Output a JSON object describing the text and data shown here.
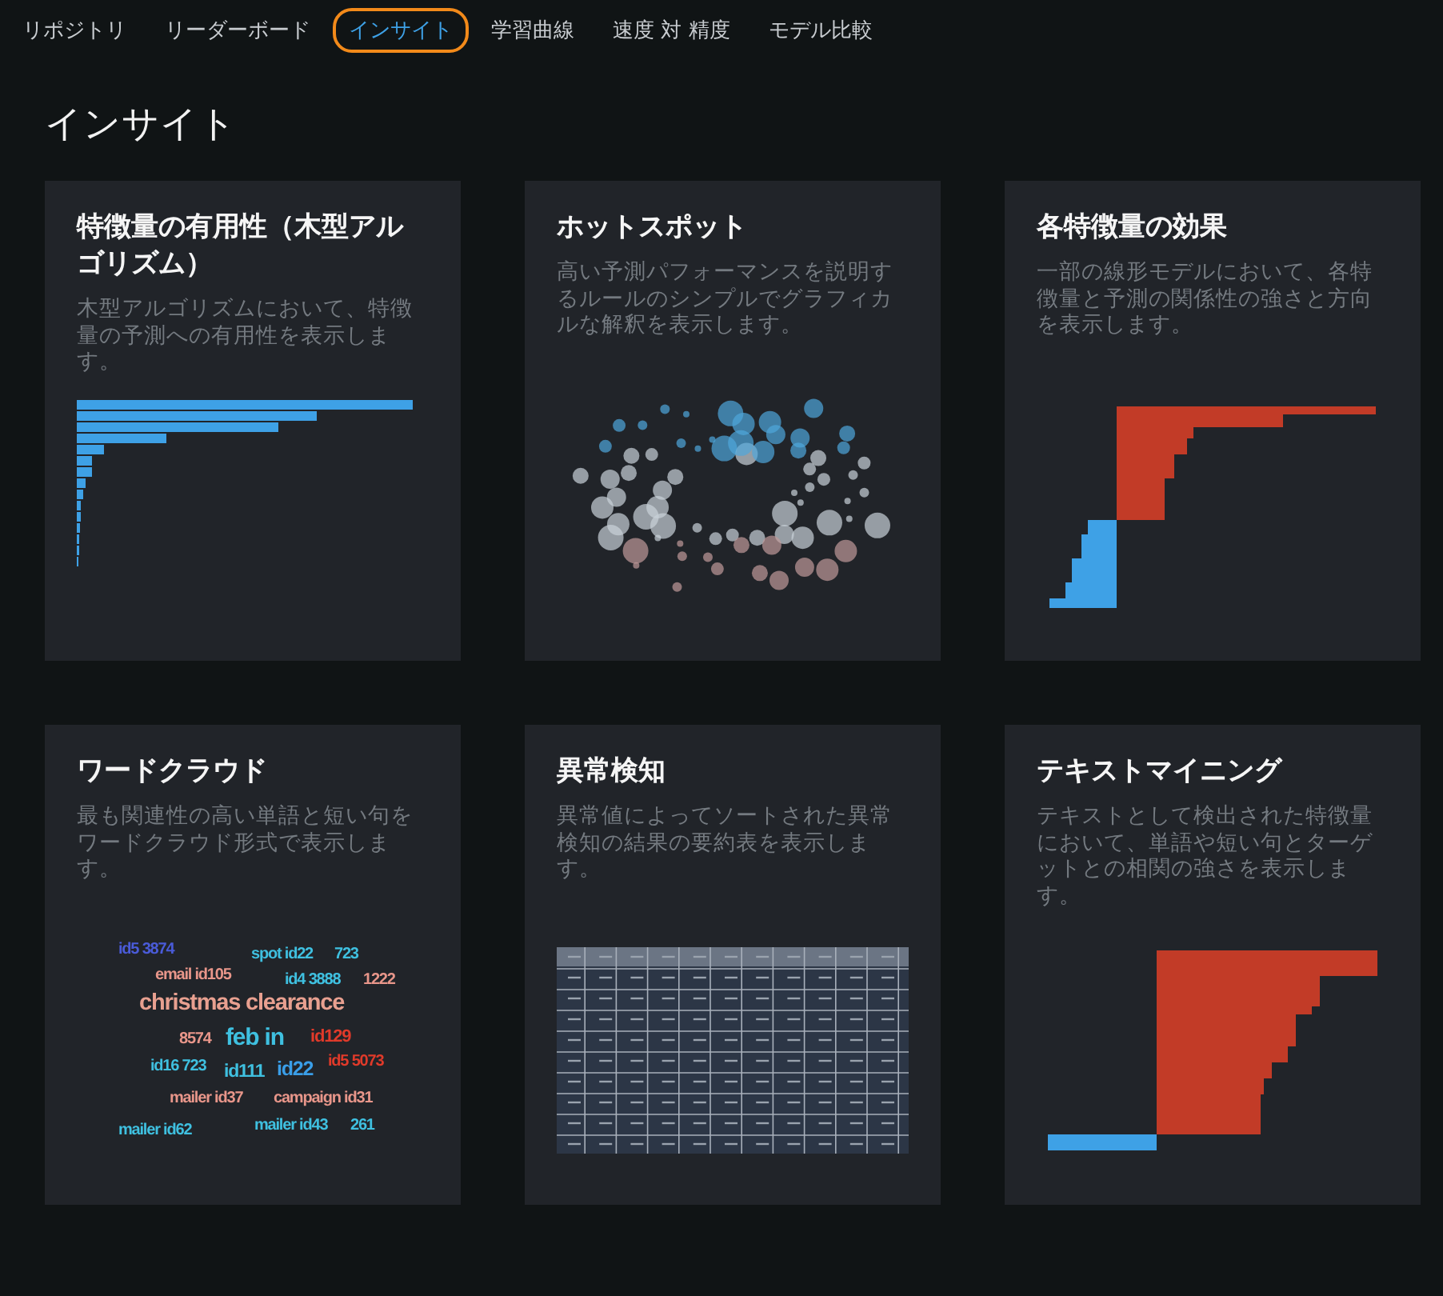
{
  "tabs": [
    {
      "label": "リポジトリ",
      "selected": false
    },
    {
      "label": "リーダーボード",
      "selected": false
    },
    {
      "label": "インサイト",
      "selected": true
    },
    {
      "label": "学習曲線",
      "selected": false
    },
    {
      "label": "速度 対 精度",
      "selected": false
    },
    {
      "label": "モデル比較",
      "selected": false
    }
  ],
  "heading": "インサイト",
  "cards": [
    {
      "kind": "bars",
      "title": "特徴量の有用性（木型アルゴリズム）",
      "description": "木型アルゴリズムにおいて、特徴量の予測への有用性を表示します。"
    },
    {
      "kind": "hotspot",
      "title": "ホットスポット",
      "description": "高い予測パフォーマンスを説明するルールのシンプルでグラフィカルな解釈を表示します。"
    },
    {
      "kind": "effects",
      "title": "各特徴量の効果",
      "description": "一部の線形モデルにおいて、各特徴量と予測の関係性の強さと方向を表示します。"
    },
    {
      "kind": "wordcloud",
      "title": "ワードクラウド",
      "description": "最も関連性の高い単語と短い句をワードクラウド形式で表示します。",
      "words": [
        {
          "text": "id5 3874",
          "color": "#4a5bd8"
        },
        {
          "text": "spot id22",
          "color": "#3fc0e0"
        },
        {
          "text": "723",
          "color": "#3fc0e0"
        },
        {
          "text": "email id105",
          "color": "#e8968a"
        },
        {
          "text": "id4 3888",
          "color": "#3fc0e0"
        },
        {
          "text": "1222",
          "color": "#e8968a"
        },
        {
          "text": "christmas clearance",
          "color": "#e8a090"
        },
        {
          "text": "8574",
          "color": "#e8968a"
        },
        {
          "text": "feb in",
          "color": "#3fc0e0"
        },
        {
          "text": "id129",
          "color": "#e03a2a"
        },
        {
          "text": "id16 723",
          "color": "#3fc0e0"
        },
        {
          "text": "id111",
          "color": "#3fc0e0"
        },
        {
          "text": "id22",
          "color": "#3a9ee8"
        },
        {
          "text": "id5 5073",
          "color": "#e03a2a"
        },
        {
          "text": "mailer id37",
          "color": "#e8968a"
        },
        {
          "text": "campaign id31",
          "color": "#e8968a"
        },
        {
          "text": "mailer id62",
          "color": "#3fc0e0"
        },
        {
          "text": "mailer id43",
          "color": "#3fc0e0"
        },
        {
          "text": "261",
          "color": "#3fc0e0"
        }
      ]
    },
    {
      "kind": "table",
      "title": "異常検知",
      "description": "異常値によってソートされた異常検知の結果の要約表を表示します。"
    },
    {
      "kind": "textmining",
      "title": "テキストマイニング",
      "description": "テキストとして検出された特徴量において、単語や短い句とターゲットとの相関の強さを表示します。"
    }
  ]
}
